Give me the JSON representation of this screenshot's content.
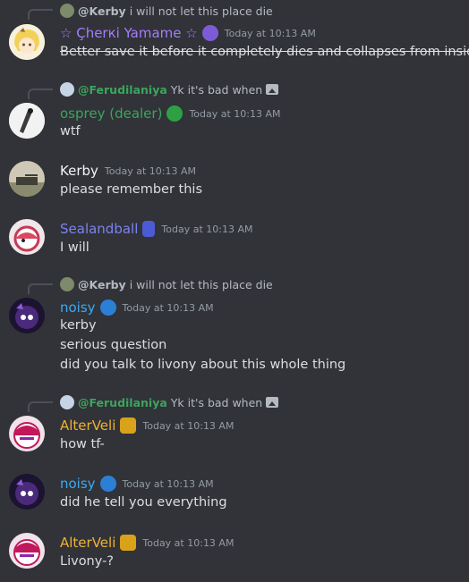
{
  "messages": [
    {
      "reply": {
        "name": "@Kerby",
        "text": "i will not let this place die",
        "color": "#dbdee1"
      },
      "author": "☆ Çherкi Yamame ☆",
      "author_color": "#a77bff",
      "timestamp": "Today at 10:13 AM",
      "lines": [
        "Better save it before it completely dies and collapses from inside"
      ]
    },
    {
      "reply": {
        "name": "@Ferudilaniya",
        "text": "Yk it's bad when",
        "color": "#3ba55c"
      },
      "author": "osprey (dealer)",
      "author_color": "#3ba55c",
      "timestamp": "Today at 10:13 AM",
      "lines": [
        "wtf"
      ]
    },
    {
      "author": "Kerby",
      "author_color": "#f2f3f5",
      "timestamp": "Today at 10:13 AM",
      "lines": [
        "please remember this"
      ]
    },
    {
      "author": "Sealandball",
      "author_color": "#7b82f2",
      "timestamp": "Today at 10:13 AM",
      "lines": [
        "I will"
      ]
    },
    {
      "reply": {
        "name": "@Kerby",
        "text": "i will not let this place die",
        "color": "#dbdee1"
      },
      "author": "noisy",
      "author_color": "#3ea8f2",
      "timestamp": "Today at 10:13 AM",
      "lines": [
        "kerby",
        "serious question",
        "did you talk to livony about this whole thing"
      ]
    },
    {
      "reply": {
        "name": "@Ferudilaniya",
        "text": "Yk it's bad when",
        "color": "#3ba55c"
      },
      "author": "AlterVeli",
      "author_color": "#f0b232",
      "timestamp": "Today at 10:13 AM",
      "lines": [
        "how tf-"
      ]
    },
    {
      "author": "noisy",
      "author_color": "#3ea8f2",
      "timestamp": "Today at 10:13 AM",
      "lines": [
        "did he tell you everything"
      ]
    },
    {
      "author": "AlterVeli",
      "author_color": "#f0b232",
      "timestamp": "Today at 10:13 AM",
      "lines": [
        "Livony-?"
      ]
    }
  ]
}
